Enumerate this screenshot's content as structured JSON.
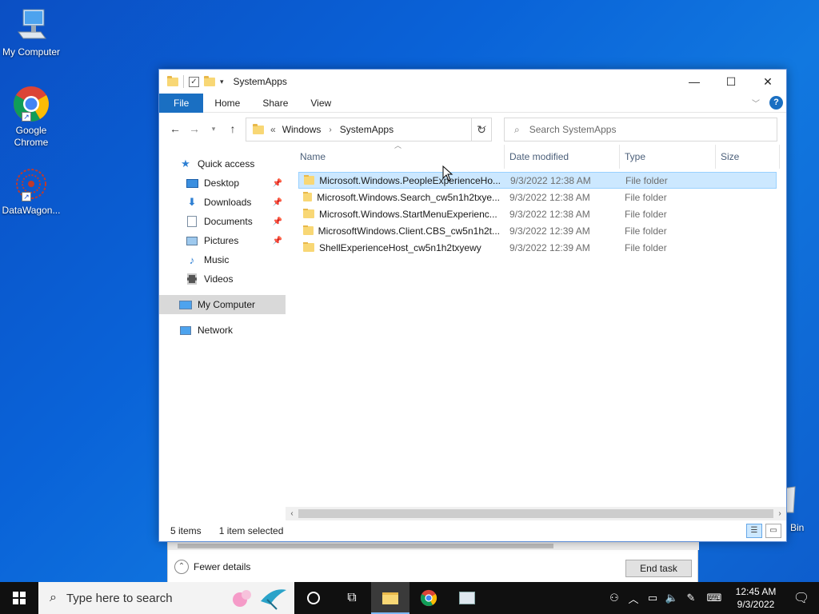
{
  "desktop": {
    "icons": [
      {
        "label": "My Computer"
      },
      {
        "label": "Google Chrome"
      },
      {
        "label": "DataWagon..."
      }
    ],
    "recycle_label": "Bin"
  },
  "explorer": {
    "title": "SystemApps",
    "ribbon_tabs": [
      "File",
      "Home",
      "Share",
      "View"
    ],
    "breadcrumb": {
      "prefix": "«",
      "parent": "Windows",
      "current": "SystemApps"
    },
    "search_placeholder": "Search SystemApps",
    "columns": {
      "name": "Name",
      "date": "Date modified",
      "type": "Type",
      "size": "Size"
    },
    "nav": [
      {
        "label": "Quick access",
        "icon": "star-icon",
        "pinned": false
      },
      {
        "label": "Desktop",
        "icon": "desktop-icon",
        "pinned": true
      },
      {
        "label": "Downloads",
        "icon": "download-icon",
        "pinned": true
      },
      {
        "label": "Documents",
        "icon": "documents-icon",
        "pinned": true
      },
      {
        "label": "Pictures",
        "icon": "pictures-icon",
        "pinned": true
      },
      {
        "label": "Music",
        "icon": "music-icon",
        "pinned": false
      },
      {
        "label": "Videos",
        "icon": "videos-icon",
        "pinned": false
      },
      {
        "label": "My Computer",
        "icon": "computer-icon",
        "selected": true
      },
      {
        "label": "Network",
        "icon": "network-icon"
      }
    ],
    "files": [
      {
        "name": "Microsoft.Windows.PeopleExperienceHo...",
        "date": "9/3/2022 12:38 AM",
        "type": "File folder",
        "selected": true
      },
      {
        "name": "Microsoft.Windows.Search_cw5n1h2txye...",
        "date": "9/3/2022 12:38 AM",
        "type": "File folder"
      },
      {
        "name": "Microsoft.Windows.StartMenuExperienc...",
        "date": "9/3/2022 12:38 AM",
        "type": "File folder"
      },
      {
        "name": "MicrosoftWindows.Client.CBS_cw5n1h2t...",
        "date": "9/3/2022 12:39 AM",
        "type": "File folder"
      },
      {
        "name": "ShellExperienceHost_cw5n1h2txyewy",
        "date": "9/3/2022 12:39 AM",
        "type": "File folder"
      }
    ],
    "status": {
      "count": "5 items",
      "selection": "1 item selected"
    }
  },
  "taskmanager": {
    "fewer_details": "Fewer details",
    "end_task": "End task"
  },
  "taskbar": {
    "search_placeholder": "Type here to search",
    "time": "12:45 AM",
    "date": "9/3/2022"
  },
  "colors": {
    "accent": "#1a6fc2",
    "selection": "#cce8ff",
    "taskbar": "#101010"
  }
}
